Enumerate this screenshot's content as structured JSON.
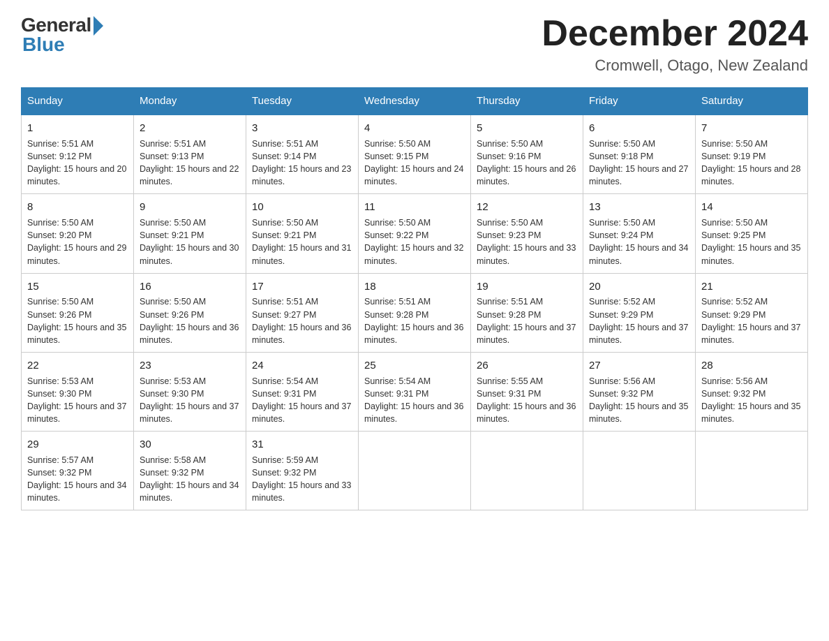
{
  "header": {
    "logo_general": "General",
    "logo_blue": "Blue",
    "title": "December 2024",
    "subtitle": "Cromwell, Otago, New Zealand"
  },
  "days_of_week": [
    "Sunday",
    "Monday",
    "Tuesday",
    "Wednesday",
    "Thursday",
    "Friday",
    "Saturday"
  ],
  "weeks": [
    [
      {
        "day": "1",
        "sunrise": "Sunrise: 5:51 AM",
        "sunset": "Sunset: 9:12 PM",
        "daylight": "Daylight: 15 hours and 20 minutes."
      },
      {
        "day": "2",
        "sunrise": "Sunrise: 5:51 AM",
        "sunset": "Sunset: 9:13 PM",
        "daylight": "Daylight: 15 hours and 22 minutes."
      },
      {
        "day": "3",
        "sunrise": "Sunrise: 5:51 AM",
        "sunset": "Sunset: 9:14 PM",
        "daylight": "Daylight: 15 hours and 23 minutes."
      },
      {
        "day": "4",
        "sunrise": "Sunrise: 5:50 AM",
        "sunset": "Sunset: 9:15 PM",
        "daylight": "Daylight: 15 hours and 24 minutes."
      },
      {
        "day": "5",
        "sunrise": "Sunrise: 5:50 AM",
        "sunset": "Sunset: 9:16 PM",
        "daylight": "Daylight: 15 hours and 26 minutes."
      },
      {
        "day": "6",
        "sunrise": "Sunrise: 5:50 AM",
        "sunset": "Sunset: 9:18 PM",
        "daylight": "Daylight: 15 hours and 27 minutes."
      },
      {
        "day": "7",
        "sunrise": "Sunrise: 5:50 AM",
        "sunset": "Sunset: 9:19 PM",
        "daylight": "Daylight: 15 hours and 28 minutes."
      }
    ],
    [
      {
        "day": "8",
        "sunrise": "Sunrise: 5:50 AM",
        "sunset": "Sunset: 9:20 PM",
        "daylight": "Daylight: 15 hours and 29 minutes."
      },
      {
        "day": "9",
        "sunrise": "Sunrise: 5:50 AM",
        "sunset": "Sunset: 9:21 PM",
        "daylight": "Daylight: 15 hours and 30 minutes."
      },
      {
        "day": "10",
        "sunrise": "Sunrise: 5:50 AM",
        "sunset": "Sunset: 9:21 PM",
        "daylight": "Daylight: 15 hours and 31 minutes."
      },
      {
        "day": "11",
        "sunrise": "Sunrise: 5:50 AM",
        "sunset": "Sunset: 9:22 PM",
        "daylight": "Daylight: 15 hours and 32 minutes."
      },
      {
        "day": "12",
        "sunrise": "Sunrise: 5:50 AM",
        "sunset": "Sunset: 9:23 PM",
        "daylight": "Daylight: 15 hours and 33 minutes."
      },
      {
        "day": "13",
        "sunrise": "Sunrise: 5:50 AM",
        "sunset": "Sunset: 9:24 PM",
        "daylight": "Daylight: 15 hours and 34 minutes."
      },
      {
        "day": "14",
        "sunrise": "Sunrise: 5:50 AM",
        "sunset": "Sunset: 9:25 PM",
        "daylight": "Daylight: 15 hours and 35 minutes."
      }
    ],
    [
      {
        "day": "15",
        "sunrise": "Sunrise: 5:50 AM",
        "sunset": "Sunset: 9:26 PM",
        "daylight": "Daylight: 15 hours and 35 minutes."
      },
      {
        "day": "16",
        "sunrise": "Sunrise: 5:50 AM",
        "sunset": "Sunset: 9:26 PM",
        "daylight": "Daylight: 15 hours and 36 minutes."
      },
      {
        "day": "17",
        "sunrise": "Sunrise: 5:51 AM",
        "sunset": "Sunset: 9:27 PM",
        "daylight": "Daylight: 15 hours and 36 minutes."
      },
      {
        "day": "18",
        "sunrise": "Sunrise: 5:51 AM",
        "sunset": "Sunset: 9:28 PM",
        "daylight": "Daylight: 15 hours and 36 minutes."
      },
      {
        "day": "19",
        "sunrise": "Sunrise: 5:51 AM",
        "sunset": "Sunset: 9:28 PM",
        "daylight": "Daylight: 15 hours and 37 minutes."
      },
      {
        "day": "20",
        "sunrise": "Sunrise: 5:52 AM",
        "sunset": "Sunset: 9:29 PM",
        "daylight": "Daylight: 15 hours and 37 minutes."
      },
      {
        "day": "21",
        "sunrise": "Sunrise: 5:52 AM",
        "sunset": "Sunset: 9:29 PM",
        "daylight": "Daylight: 15 hours and 37 minutes."
      }
    ],
    [
      {
        "day": "22",
        "sunrise": "Sunrise: 5:53 AM",
        "sunset": "Sunset: 9:30 PM",
        "daylight": "Daylight: 15 hours and 37 minutes."
      },
      {
        "day": "23",
        "sunrise": "Sunrise: 5:53 AM",
        "sunset": "Sunset: 9:30 PM",
        "daylight": "Daylight: 15 hours and 37 minutes."
      },
      {
        "day": "24",
        "sunrise": "Sunrise: 5:54 AM",
        "sunset": "Sunset: 9:31 PM",
        "daylight": "Daylight: 15 hours and 37 minutes."
      },
      {
        "day": "25",
        "sunrise": "Sunrise: 5:54 AM",
        "sunset": "Sunset: 9:31 PM",
        "daylight": "Daylight: 15 hours and 36 minutes."
      },
      {
        "day": "26",
        "sunrise": "Sunrise: 5:55 AM",
        "sunset": "Sunset: 9:31 PM",
        "daylight": "Daylight: 15 hours and 36 minutes."
      },
      {
        "day": "27",
        "sunrise": "Sunrise: 5:56 AM",
        "sunset": "Sunset: 9:32 PM",
        "daylight": "Daylight: 15 hours and 35 minutes."
      },
      {
        "day": "28",
        "sunrise": "Sunrise: 5:56 AM",
        "sunset": "Sunset: 9:32 PM",
        "daylight": "Daylight: 15 hours and 35 minutes."
      }
    ],
    [
      {
        "day": "29",
        "sunrise": "Sunrise: 5:57 AM",
        "sunset": "Sunset: 9:32 PM",
        "daylight": "Daylight: 15 hours and 34 minutes."
      },
      {
        "day": "30",
        "sunrise": "Sunrise: 5:58 AM",
        "sunset": "Sunset: 9:32 PM",
        "daylight": "Daylight: 15 hours and 34 minutes."
      },
      {
        "day": "31",
        "sunrise": "Sunrise: 5:59 AM",
        "sunset": "Sunset: 9:32 PM",
        "daylight": "Daylight: 15 hours and 33 minutes."
      },
      null,
      null,
      null,
      null
    ]
  ]
}
